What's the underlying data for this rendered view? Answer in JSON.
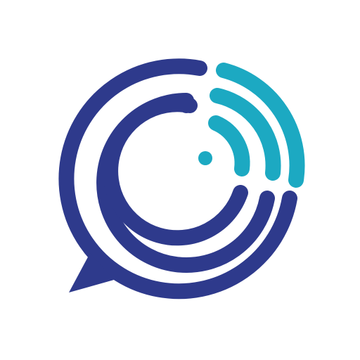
{
  "logo": {
    "icon_name": "chat-bubble-signal-logo-icon",
    "colors": {
      "primary": "#2E3A8C",
      "accent": "#1CA9C2",
      "background": "#FFFFFF"
    }
  }
}
